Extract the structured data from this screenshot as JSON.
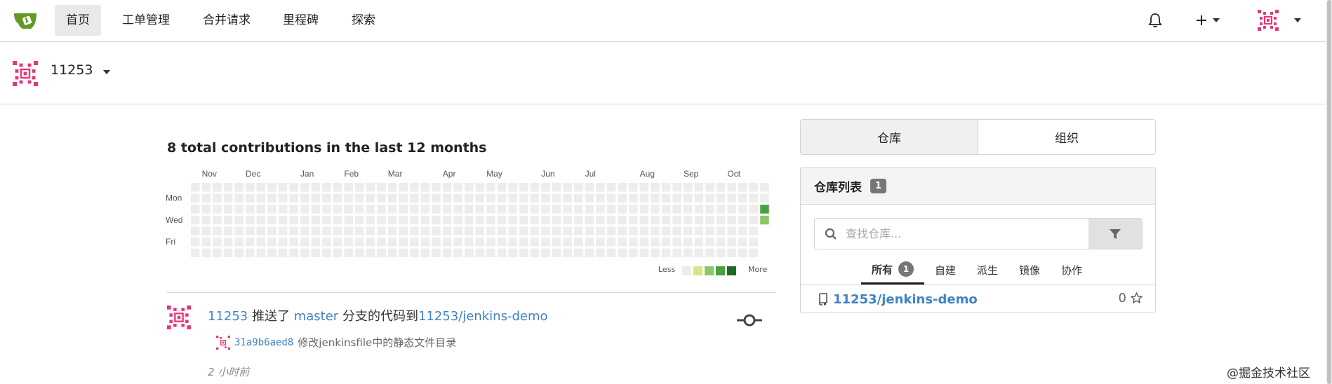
{
  "nav": {
    "items": [
      {
        "label": "首页",
        "active": true
      },
      {
        "label": "工单管理"
      },
      {
        "label": "合并请求"
      },
      {
        "label": "里程碑"
      },
      {
        "label": "探索"
      }
    ]
  },
  "user": {
    "name": "11253"
  },
  "heatmap": {
    "title": "8 total contributions in the last 12 months",
    "months": [
      "Nov",
      "Dec",
      "Jan",
      "Feb",
      "Mar",
      "Apr",
      "May",
      "Jun",
      "Jul",
      "Aug",
      "Sep",
      "Oct"
    ],
    "days": [
      "Mon",
      "Wed",
      "Fri"
    ],
    "legend_less": "Less",
    "legend_more": "More",
    "colors": [
      "#ededed",
      "#d6e685",
      "#8cc665",
      "#44a340",
      "#1e6823"
    ],
    "weeks": 53,
    "active_cells": [
      {
        "week": 52,
        "day": 2,
        "level": 3
      },
      {
        "week": 52,
        "day": 3,
        "level": 2
      }
    ]
  },
  "feed": {
    "actor": "11253",
    "verb": "推送了",
    "branch": "master",
    "middle": "分支的代码到",
    "repo": "11253/jenkins-demo",
    "commit_sha": "31a9b6aed8",
    "commit_msg": "修改jenkinsfile中的静态文件目录",
    "time": "2 小时前"
  },
  "right": {
    "tabs": [
      {
        "label": "仓库",
        "active": true
      },
      {
        "label": "组织"
      }
    ],
    "repo_list_title": "仓库列表",
    "repo_count": "1",
    "search_placeholder": "查找仓库...",
    "subtabs": [
      {
        "label": "所有",
        "count": "1",
        "active": true
      },
      {
        "label": "自建"
      },
      {
        "label": "派生"
      },
      {
        "label": "镜像"
      },
      {
        "label": "协作"
      }
    ],
    "repo": {
      "name": "11253/jenkins-demo",
      "stars": "0"
    }
  },
  "watermark": "@掘金技术社区",
  "theme": {
    "accent": "#4183c4"
  }
}
